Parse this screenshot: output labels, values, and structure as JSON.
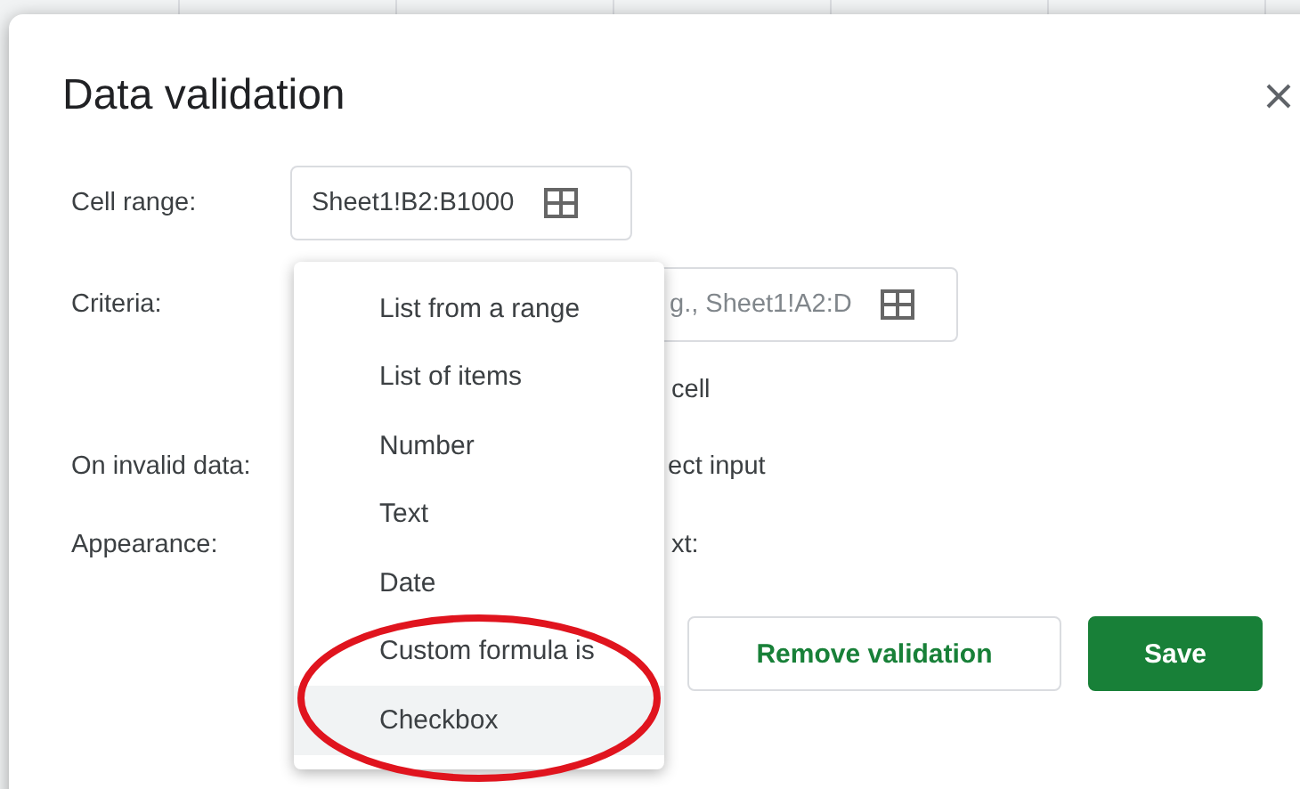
{
  "window": {
    "title": "Data validation"
  },
  "cell_range": {
    "label": "Cell range:",
    "value": "Sheet1!B2:B1000"
  },
  "criteria": {
    "label": "Criteria:",
    "placeholder": "g., Sheet1!A2:D"
  },
  "show_dropdown": {
    "text": "cell"
  },
  "on_invalid": {
    "label": "On invalid data:",
    "text": "ect input"
  },
  "appearance": {
    "label": "Appearance:",
    "text": "xt:"
  },
  "criteria_menu": [
    {
      "label": "List from a range",
      "selected": false
    },
    {
      "label": "List of items",
      "selected": false
    },
    {
      "label": "Number",
      "selected": false
    },
    {
      "label": "Text",
      "selected": false
    },
    {
      "label": "Date",
      "selected": false
    },
    {
      "label": "Custom formula is",
      "selected": false
    },
    {
      "label": "Checkbox",
      "selected": true
    }
  ],
  "buttons": [
    {
      "label": "Remove validation",
      "kind": "secondary"
    },
    {
      "label": "Save",
      "kind": "primary"
    }
  ]
}
